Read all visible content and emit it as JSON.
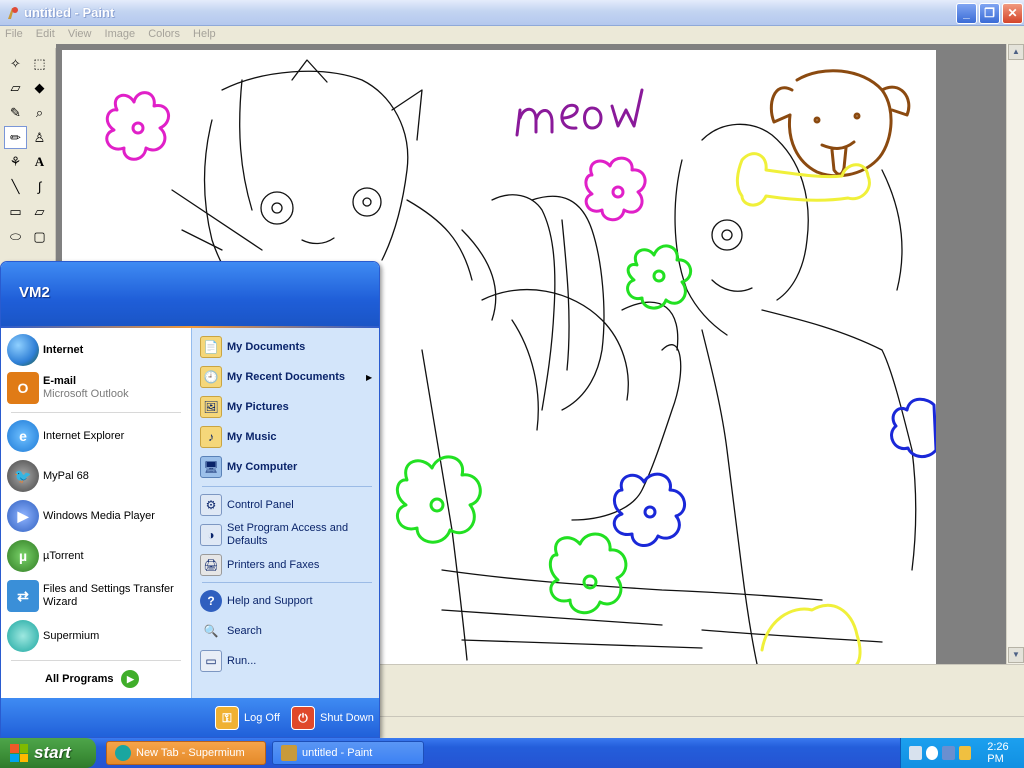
{
  "window": {
    "title": "untitled - Paint",
    "controls": {
      "minimize": "_",
      "maximize": "❐",
      "close": "✕"
    }
  },
  "menu": [
    "File",
    "Edit",
    "View",
    "Image",
    "Colors",
    "Help"
  ],
  "canvas": {
    "drawn_text": "meow"
  },
  "start_menu": {
    "user": "VM2",
    "pinned": [
      {
        "label": "Internet",
        "icon": "globe-icon",
        "color": "#2f7fd6"
      },
      {
        "label": "E-mail",
        "sublabel": "Microsoft Outlook",
        "icon": "outlook-icon",
        "color": "#e07b16"
      }
    ],
    "recent": [
      {
        "label": "Internet Explorer",
        "icon": "internet-explorer-icon",
        "color": "#1c79d6"
      },
      {
        "label": "MyPal 68",
        "icon": "mypal-icon",
        "color": "#555555"
      },
      {
        "label": "Windows Media Player",
        "icon": "media-player-icon",
        "color": "#2f5fbf"
      },
      {
        "label": "µTorrent",
        "icon": "utorrent-icon",
        "color": "#3c9a2f"
      },
      {
        "label": "Files and Settings Transfer Wizard",
        "icon": "transfer-wizard-icon",
        "color": "#3a8fd8"
      },
      {
        "label": "Supermium",
        "icon": "supermium-icon",
        "color": "#1aa6a0"
      }
    ],
    "all_programs": "All Programs",
    "places": [
      {
        "label": "My Documents",
        "bold": true,
        "icon": "folder-documents-icon"
      },
      {
        "label": "My Recent Documents",
        "bold": true,
        "icon": "recent-documents-icon",
        "submenu": true
      },
      {
        "label": "My Pictures",
        "bold": true,
        "icon": "folder-pictures-icon"
      },
      {
        "label": "My Music",
        "bold": true,
        "icon": "folder-music-icon"
      },
      {
        "label": "My Computer",
        "bold": true,
        "icon": "computer-icon"
      },
      {
        "label": "Control Panel",
        "bold": false,
        "icon": "control-panel-icon"
      },
      {
        "label": "Set Program Access and Defaults",
        "bold": false,
        "icon": "program-defaults-icon"
      },
      {
        "label": "Printers and Faxes",
        "bold": false,
        "icon": "printer-icon"
      },
      {
        "label": "Help and Support",
        "bold": false,
        "icon": "help-icon"
      },
      {
        "label": "Search",
        "bold": false,
        "icon": "search-icon"
      },
      {
        "label": "Run...",
        "bold": false,
        "icon": "run-icon"
      }
    ],
    "log_off": "Log Off",
    "shut_down": "Shut Down"
  },
  "taskbar": {
    "start": "start",
    "tasks": [
      {
        "label": "New Tab - Supermium",
        "active": false
      },
      {
        "label": "untitled - Paint",
        "active": true
      }
    ],
    "clock": "2:26 PM"
  },
  "colors": {
    "xp_blue": "#245edb",
    "start_green": "#3c8e37",
    "supermium_task": "#e48a2a",
    "paint_task": "#3c81f3"
  }
}
